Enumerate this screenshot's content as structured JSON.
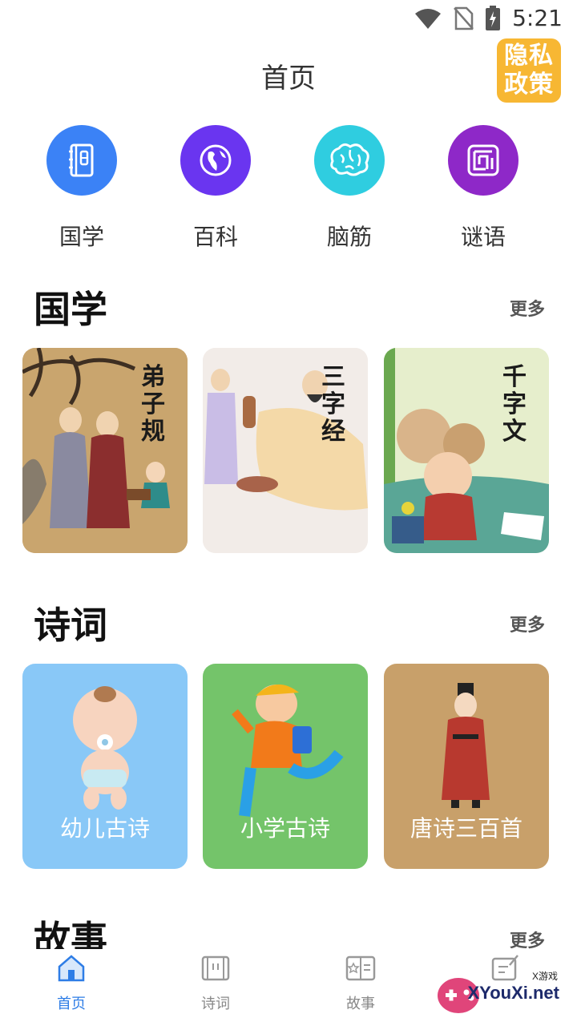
{
  "status_bar": {
    "time": "5:21",
    "icons": [
      "wifi-icon",
      "no-sim-icon",
      "battery-charging-icon"
    ]
  },
  "header": {
    "title": "首页",
    "privacy_badge": "隐私政策",
    "privacy_line1": "隐私",
    "privacy_line2": "政策"
  },
  "quick_nav": [
    {
      "label": "国学",
      "icon": "book-icon",
      "color": "#3b82f6"
    },
    {
      "label": "百科",
      "icon": "globe-icon",
      "color": "#6a35f0"
    },
    {
      "label": "脑筋",
      "icon": "brain-icon",
      "color": "#2fcde0"
    },
    {
      "label": "谜语",
      "icon": "maze-icon",
      "color": "#8e28c8"
    }
  ],
  "sections": {
    "guoxue": {
      "title": "国学",
      "more": "更多",
      "cards": [
        {
          "title": "弟子规",
          "chars": [
            "弟",
            "子",
            "规"
          ]
        },
        {
          "title": "三字经",
          "chars": [
            "三",
            "字",
            "经"
          ]
        },
        {
          "title": "千字文",
          "chars": [
            "千",
            "字",
            "文"
          ]
        }
      ]
    },
    "shici": {
      "title": "诗词",
      "more": "更多",
      "cards": [
        {
          "label": "幼儿古诗",
          "color": "#89c8f7"
        },
        {
          "label": "小学古诗",
          "color": "#74c46a"
        },
        {
          "label": "唐诗三百首",
          "color": "#c8a06a"
        }
      ]
    },
    "gushi": {
      "title": "故事",
      "more": "更多"
    }
  },
  "bottom_nav": [
    {
      "label": "首页",
      "icon": "home-icon",
      "active": true
    },
    {
      "label": "诗词",
      "icon": "scroll-icon",
      "active": false
    },
    {
      "label": "故事",
      "icon": "storybook-icon",
      "active": false
    },
    {
      "label": "",
      "icon": "edit-icon",
      "active": false
    }
  ],
  "watermark": {
    "text": "XYouXi.net",
    "small": "X游戏"
  },
  "colors": {
    "accent": "#2e7de6",
    "privacy": "#f7b733"
  }
}
